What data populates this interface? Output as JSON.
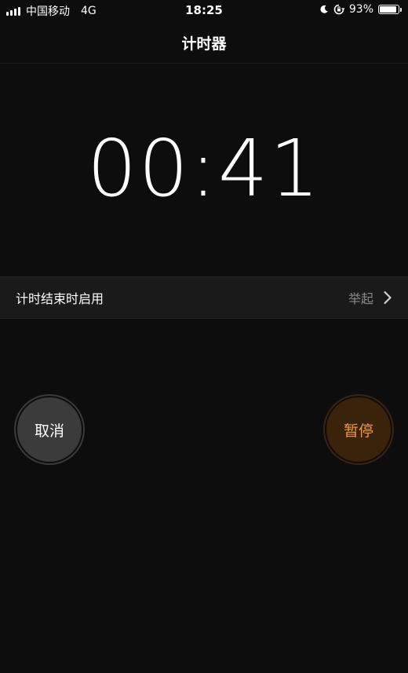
{
  "status_bar": {
    "carrier": "中国移动",
    "network": "4G",
    "time": "18:25",
    "battery": "93%",
    "battery_level": 0.93
  },
  "nav": {
    "title": "计时器"
  },
  "timer": {
    "display": "00:41"
  },
  "alert_row": {
    "label": "计时结束时启用",
    "value": "举起"
  },
  "buttons": {
    "cancel_label": "取消",
    "pause_label": "暂停"
  },
  "colors": {
    "background": "#0d0d0d",
    "pause_accent": "#f09a36",
    "pause_fill": "#3a230b",
    "cancel_fill": "#3b3b3b",
    "secondary_text": "#8a8a8a"
  },
  "icons": {
    "signal": "signal-icon",
    "moon": "moon-icon",
    "rotation_lock": "lock-rotation-icon",
    "battery": "battery-icon",
    "chevron": "chevron-right-icon"
  }
}
